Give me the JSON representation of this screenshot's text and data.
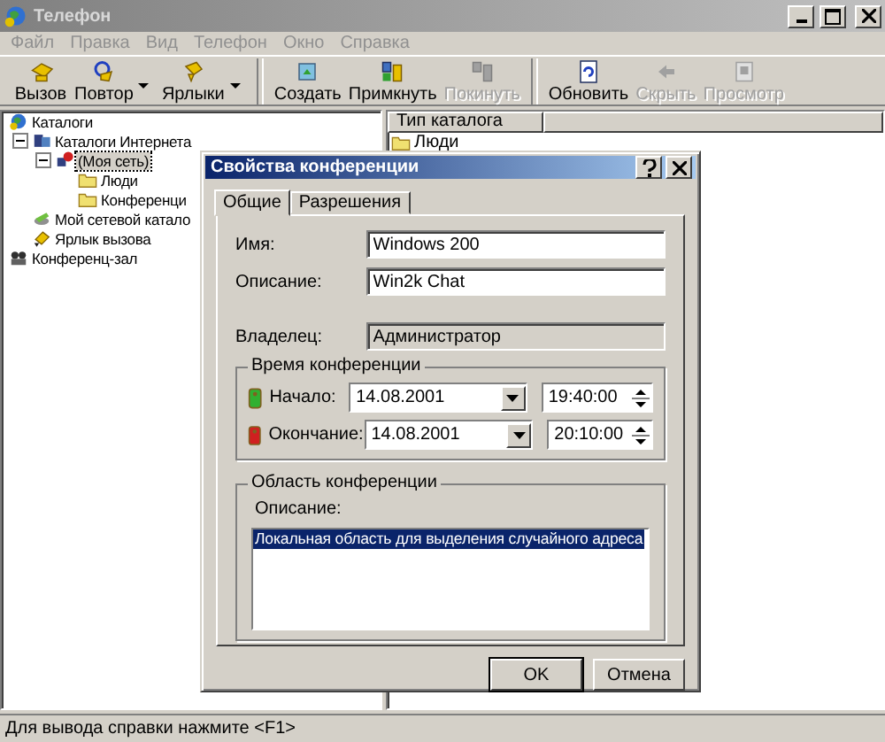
{
  "window": {
    "title": "Телефон"
  },
  "menu": [
    "Файл",
    "Правка",
    "Вид",
    "Телефон",
    "Окно",
    "Справка"
  ],
  "toolbar": [
    [
      {
        "label": "Вызов",
        "kind": "call",
        "dropdown": false,
        "disabled": false
      },
      {
        "label": "Повтор",
        "kind": "redial",
        "dropdown": true,
        "disabled": false
      },
      {
        "label": "Ярлыки",
        "kind": "shortcuts",
        "dropdown": true,
        "disabled": false
      }
    ],
    [
      {
        "label": "Создать",
        "kind": "create",
        "dropdown": false,
        "disabled": false
      },
      {
        "label": "Примкнуть",
        "kind": "join",
        "dropdown": false,
        "disabled": false
      },
      {
        "label": "Покинуть",
        "kind": "leave",
        "dropdown": false,
        "disabled": true
      }
    ],
    [
      {
        "label": "Обновить",
        "kind": "refresh",
        "dropdown": false,
        "disabled": false
      },
      {
        "label": "Скрыть",
        "kind": "hide",
        "dropdown": false,
        "disabled": true
      },
      {
        "label": "Просмотр",
        "kind": "preview",
        "dropdown": false,
        "disabled": true
      }
    ]
  ],
  "tree": [
    {
      "label": "Каталоги",
      "kind": "globe",
      "selected": false,
      "children": [
        {
          "label": "Каталоги Интернета",
          "kind": "server",
          "selected": false,
          "expanded": true,
          "children": [
            {
              "label": "(Моя сеть)",
              "kind": "network",
              "selected": true,
              "expanded": true,
              "children": [
                {
                  "label": "Люди",
                  "kind": "folder",
                  "selected": false
                },
                {
                  "label": "Конференци",
                  "kind": "folder",
                  "selected": false
                }
              ]
            }
          ]
        },
        {
          "label": "Мой сетевой катало",
          "kind": "disk",
          "selected": false
        },
        {
          "label": "Ярлык вызова",
          "kind": "shortcut",
          "selected": false
        }
      ]
    },
    {
      "label": "Конференц-зал",
      "kind": "conference",
      "selected": false
    }
  ],
  "list": {
    "columns": [
      "Тип каталога"
    ],
    "rows": [
      {
        "name": "Люди"
      }
    ]
  },
  "dialog": {
    "title": "Свойства конференции",
    "tabs": [
      {
        "label": "Общие",
        "selected": true
      },
      {
        "label": "Разрешения",
        "selected": false
      }
    ],
    "fields": [
      {
        "label": "Имя:",
        "value": "Windows 200",
        "disabled": false
      },
      {
        "label": "Описание:",
        "value": "Win2k Chat",
        "disabled": false
      },
      {
        "label": "Владелец:",
        "value": "Администратор",
        "disabled": true
      }
    ],
    "time_group": {
      "title": "Время конференции",
      "rows": [
        {
          "label": "Начало:",
          "color": "#30b030",
          "date": "14.08.2001",
          "time": "19:40:00"
        },
        {
          "label": "Окончание:",
          "color": "#d02020",
          "date": "14.08.2001",
          "time": "20:10:00"
        }
      ]
    },
    "scope_group": {
      "title": "Область конференции",
      "label": "Описание:",
      "items": [
        {
          "text": "Локальная область для выделения случайного адреса",
          "selected": true
        }
      ]
    },
    "buttons": [
      {
        "label": "OK",
        "default": true
      },
      {
        "label": "Отмена",
        "default": false
      }
    ]
  },
  "status_bar": "Для вывода справки нажмите <F1>"
}
